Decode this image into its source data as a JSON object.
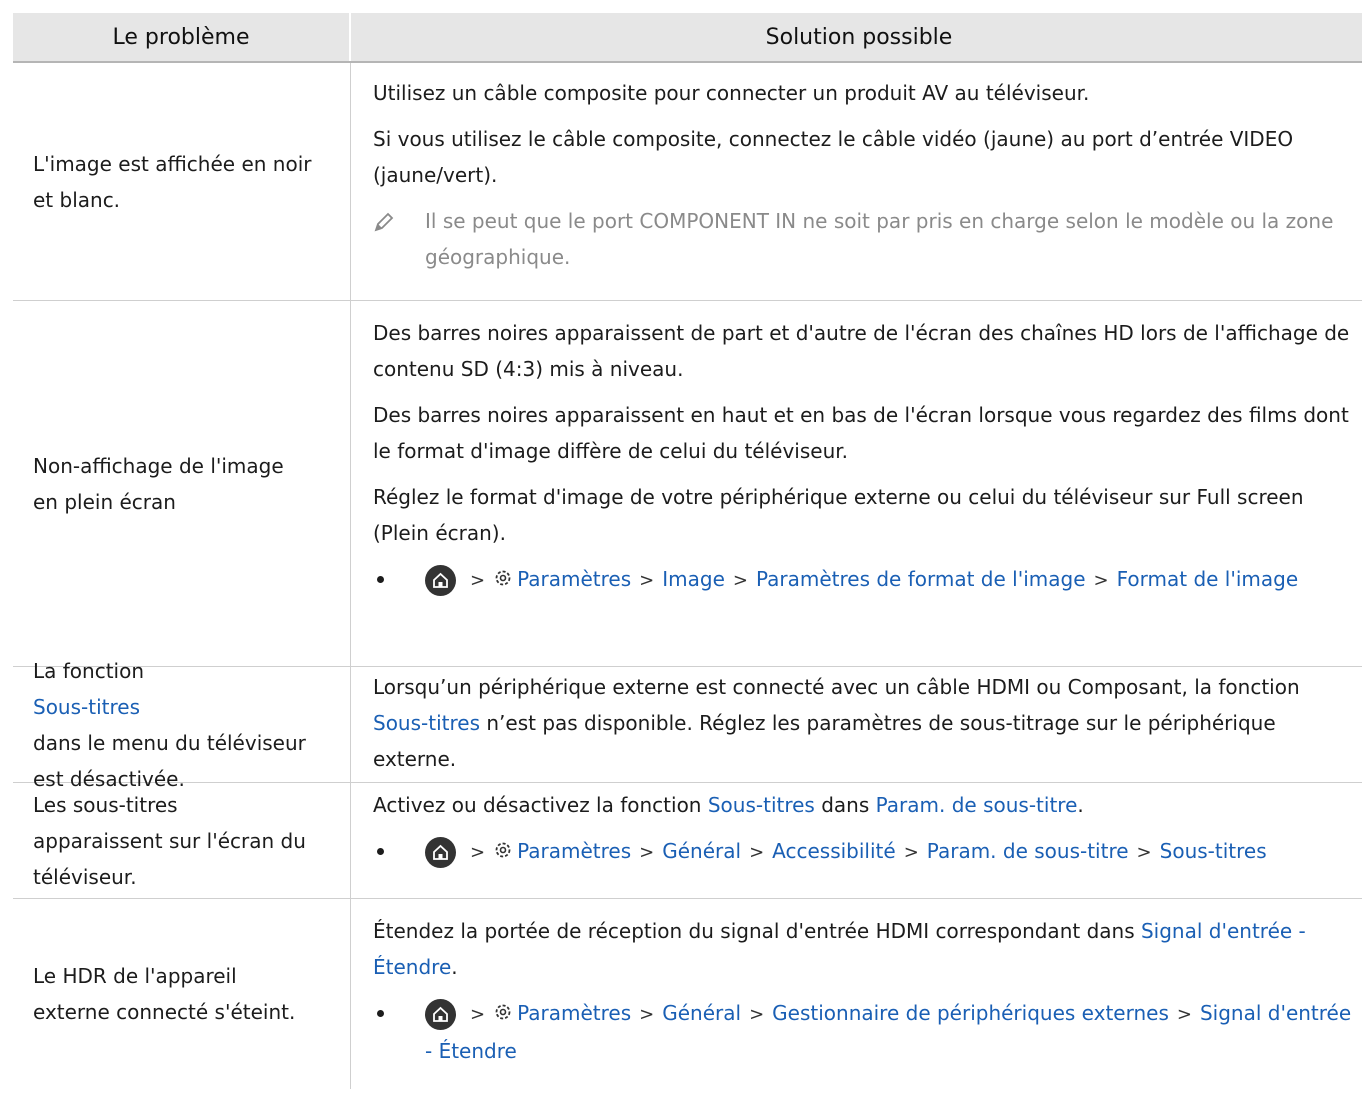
{
  "header": {
    "col1": "Le problème",
    "col2": "Solution possible"
  },
  "rows": [
    {
      "problem": [
        "L'image est affichée en noir",
        "et blanc."
      ],
      "paras": [
        "Utilisez un câble composite pour connecter un produit AV au téléviseur.",
        "Si vous utilisez le câble composite, connectez le câble vidéo (jaune) au port d’entrée VIDEO (jaune/vert)."
      ],
      "note": "Il se peut que le port COMPONENT IN ne soit par pris en charge selon le modèle ou la zone géographique."
    },
    {
      "problem": [
        "Non-affichage de l'image",
        "en plein écran"
      ],
      "paras": [
        "Des barres noires apparaissent de part et d'autre de l'écran des chaînes HD lors de l'affichage de contenu SD (4:3) mis à niveau.",
        "Des barres noires apparaissent en haut et en bas de l'écran lorsque vous regardez des films dont le format d'image diffère de celui du téléviseur.",
        "Réglez le format d'image de votre périphérique externe ou celui du téléviseur sur Full screen (Plein écran)."
      ],
      "path": [
        "Paramètres",
        "Image",
        "Paramètres de format de l'image",
        "Format de l'image"
      ]
    },
    {
      "problem_pre": "La fonction",
      "problem_link": "Sous-titres",
      "problem_post": [
        "dans le menu du téléviseur",
        "est désactivée."
      ],
      "text_a": "Lorsqu’un périphérique externe est connecté avec un câble HDMI ou Composant, la fonction",
      "text_link": "Sous-titres",
      "text_b": "n’est pas disponible. Réglez les paramètres de sous-titrage sur le périphérique externe."
    },
    {
      "problem": [
        "Les sous-titres",
        "apparaissent sur l'écran du",
        "téléviseur."
      ],
      "text_a": "Activez ou désactivez la fonction",
      "link1": "Sous-titres",
      "text_mid": "dans",
      "link2": "Param. de sous-titre",
      "text_end": ".",
      "path": [
        "Paramètres",
        "Général",
        "Accessibilité",
        "Param. de sous-titre",
        "Sous-titres"
      ]
    },
    {
      "problem": [
        "Le HDR de l'appareil",
        "externe connecté s'éteint."
      ],
      "text_a": "Étendez la portée de réception du signal d'entrée HDMI correspondant dans",
      "link1": "Signal d'entrée - Étendre",
      "text_end": ".",
      "path": [
        "Paramètres",
        "Général",
        "Gestionnaire de périphériques externes",
        "Signal d'entrée - Étendre"
      ]
    }
  ],
  "colors": {
    "link": "#1a5fb4",
    "header_bg": "#e6e6e6",
    "note": "#8a8a8a"
  },
  "icons": {
    "home": "home-icon",
    "settings": "gear-icon",
    "note": "pencil-icon",
    "separator": "chevron-right-icon"
  }
}
